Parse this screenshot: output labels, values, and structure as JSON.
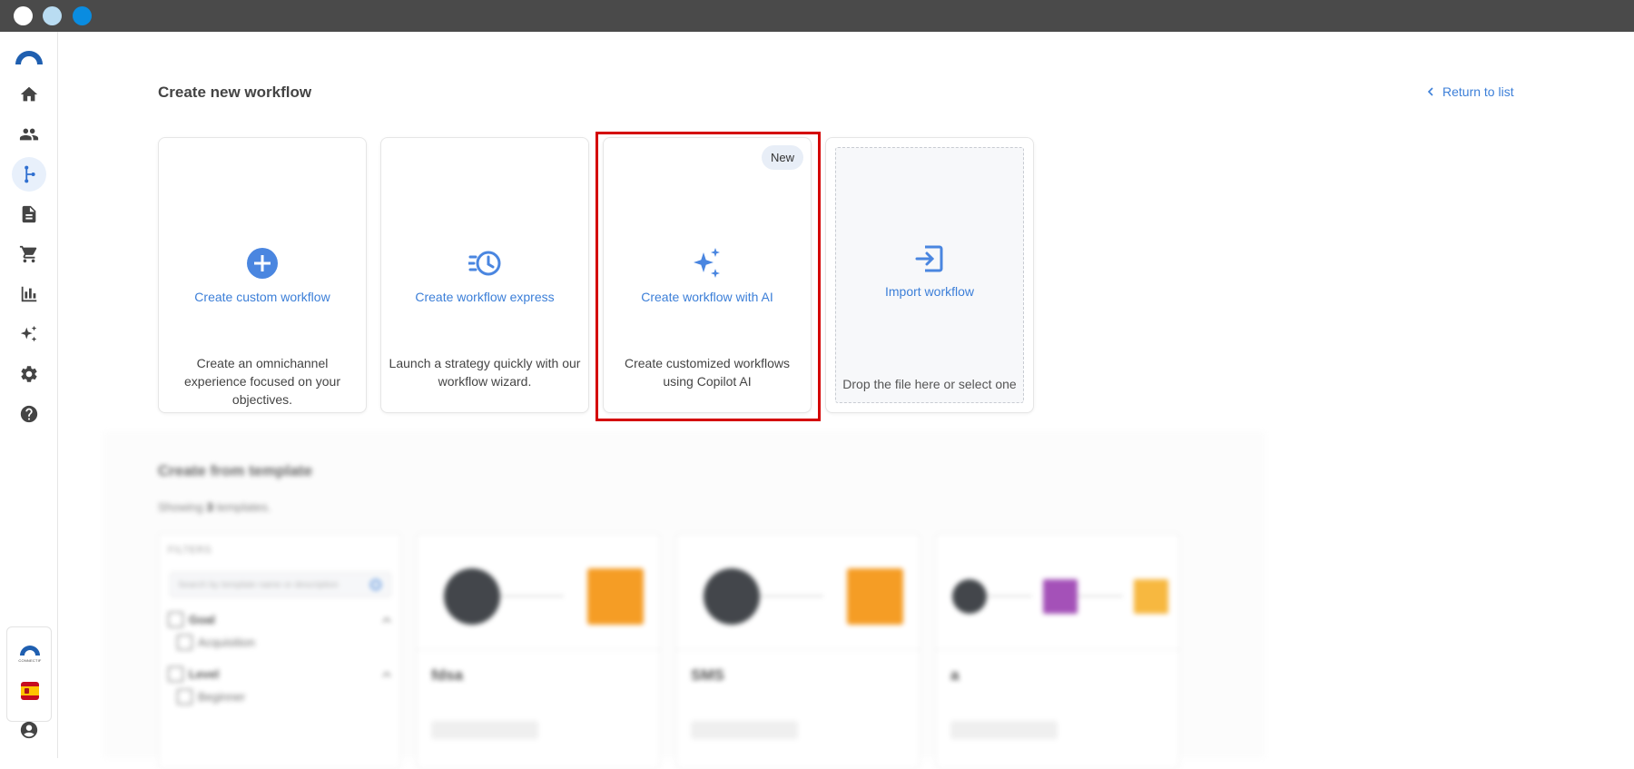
{
  "window": {
    "controls": [
      "close",
      "minimize",
      "maximize"
    ]
  },
  "sidebar": {
    "items": [
      {
        "name": "home",
        "icon": "home-icon",
        "active": false
      },
      {
        "name": "contacts",
        "icon": "people-icon",
        "active": false
      },
      {
        "name": "workflows",
        "icon": "workflow-icon",
        "active": true
      },
      {
        "name": "documents",
        "icon": "document-icon",
        "active": false
      },
      {
        "name": "commerce",
        "icon": "cart-icon",
        "active": false
      },
      {
        "name": "reports",
        "icon": "bar-chart-icon",
        "active": false
      },
      {
        "name": "ai",
        "icon": "sparkles-icon",
        "active": false
      },
      {
        "name": "settings",
        "icon": "gear-icon",
        "active": false
      },
      {
        "name": "help",
        "icon": "help-icon",
        "active": false
      }
    ],
    "brand_text": "CONNECTIF",
    "language_flag": "spain-flag-icon"
  },
  "header": {
    "title": "Create new workflow",
    "return_link": "Return to list"
  },
  "options": [
    {
      "title": "Create custom workflow",
      "description": "Create an omnichannel experience focused on your objectives.",
      "icon": "plus-circle-icon"
    },
    {
      "title": "Create workflow express",
      "description": "Launch a strategy quickly with our workflow wizard.",
      "icon": "clock-fast-icon"
    },
    {
      "title": "Create workflow with AI",
      "description": "Create customized workflows using Copilot AI",
      "icon": "sparkles-icon",
      "badge": "New"
    },
    {
      "title": "Import workflow",
      "description": "Drop the file here or select one",
      "icon": "import-icon"
    }
  ],
  "templates": {
    "title": "Create from template",
    "count_prefix": "Showing",
    "count": "3",
    "count_suffix": "templates.",
    "filters": {
      "label": "FILTERS",
      "search_placeholder": "Search by template name or description",
      "groups": [
        {
          "label": "Goal",
          "options": [
            "Acquisition"
          ]
        },
        {
          "label": "Level",
          "options": [
            "Beginner"
          ]
        }
      ]
    },
    "cards": [
      {
        "name": "fdsa"
      },
      {
        "name": "SMS"
      },
      {
        "name": "a"
      }
    ]
  },
  "colors": {
    "accent": "#3c7fd8",
    "highlight": "#d40000",
    "titlebar": "#4a4a4a"
  }
}
